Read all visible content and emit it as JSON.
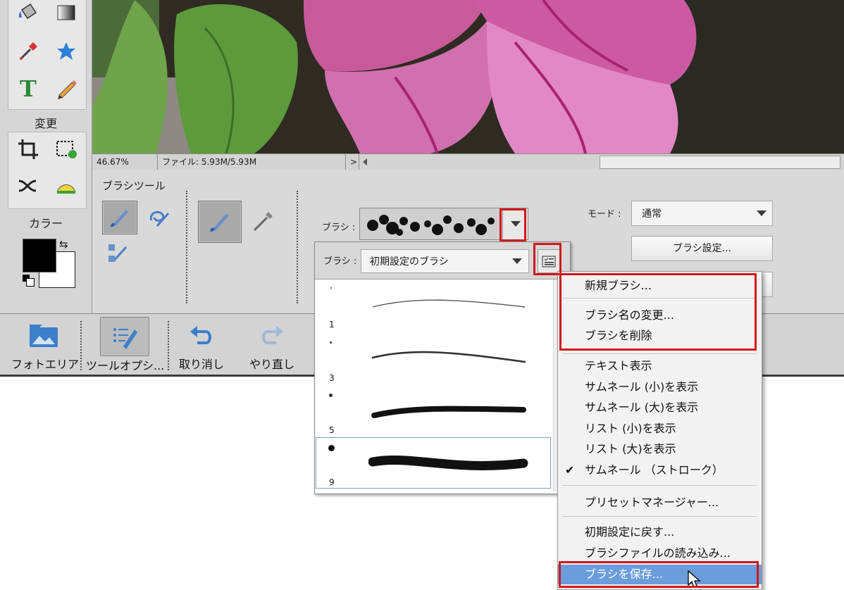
{
  "toolbox": {
    "section_modify": "変更",
    "section_color": "カラー"
  },
  "statusbar": {
    "zoom": "46.67%",
    "file_info": "ファイル: 5.93M/5.93M",
    "nav_arrow": ">"
  },
  "tool_options": {
    "title": "ブラシツール",
    "brush_label": "ブラシ :",
    "mode_label": "モード :",
    "mode_value": "通常",
    "brush_settings_button": "ブラシ設定..."
  },
  "brush_panel": {
    "brush_label": "ブラシ :",
    "set_value": "初期設定のブラシ",
    "brushes": [
      {
        "size": "1"
      },
      {
        "size": "3"
      },
      {
        "size": "5"
      },
      {
        "size": "9"
      }
    ]
  },
  "menu": {
    "items": [
      "新規ブラシ...",
      "ブラシ名の変更...",
      "ブラシを削除",
      "テキスト表示",
      "サムネール (小)を表示",
      "サムネール (大)を表示",
      "リスト (小)を表示",
      "リスト (大)を表示",
      "サムネール （ストローク）",
      "プリセットマネージャー...",
      "初期設定に戻す...",
      "ブラシファイルの読み込み...",
      "ブラシを保存..."
    ],
    "checked_item": "サムネール （ストローク）",
    "highlighted_item": "ブラシを保存..."
  },
  "taskbar": {
    "photo_area": "フォトエリア",
    "tool_options": "ツールオプシ...",
    "undo": "取り消し",
    "redo": "やり直し"
  },
  "colors": {
    "highlight": "#6b9cdb",
    "annotation_red": "#d21818",
    "foreground": "#000000",
    "background": "#ffffff"
  },
  "icons": [
    "paint-bucket-icon",
    "gradient-icon",
    "eyedropper-icon",
    "shape-star-icon",
    "text-tool-icon",
    "pencil-icon",
    "crop-icon",
    "recompose-icon",
    "content-move-icon",
    "straighten-icon",
    "brush-icon",
    "impressionist-brush-icon",
    "color-replacement-icon",
    "brush-tool-icon",
    "airbrush-icon",
    "photo-area-icon",
    "tool-options-icon",
    "undo-icon",
    "redo-icon",
    "panel-menu-icon",
    "mouse-pointer-icon"
  ]
}
